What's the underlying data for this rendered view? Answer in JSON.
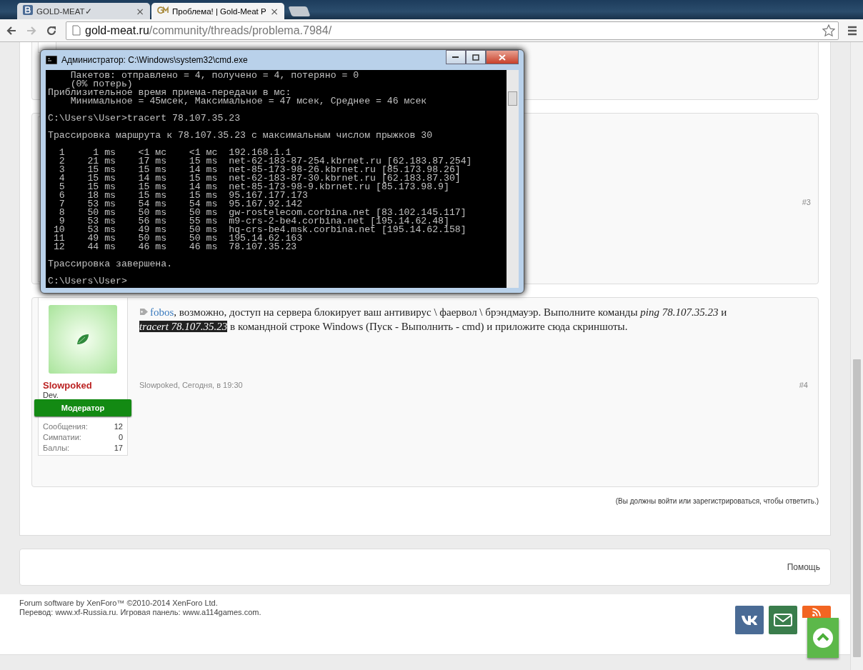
{
  "browser": {
    "tabs": [
      {
        "title": "GOLD-MEAT✓",
        "selected": false
      },
      {
        "title": "Проблема! | Gold-Meat P",
        "selected": true
      }
    ],
    "close_glyph": "×",
    "url_host": "gold-meat.ru",
    "url_path": "/community/threads/problema.7984/"
  },
  "earlier_post_number": "#3",
  "console": {
    "title": "Администратор: C:\\Windows\\system32\\cmd.exe",
    "blocks": [
      [
        "    Пакетов: отправлено = 4, получено = 4, потеряно = 0",
        "    (0% потерь)",
        "Приблизительное время приема-передачи в мс:",
        "    Минимальное = 45мсек, Максимальное = 47 мсек, Среднее = 46 мсек"
      ],
      [
        "C:\\Users\\User>tracert 78.107.35.23"
      ],
      [
        "Трассировка маршрута к 78.107.35.23 с максимальным числом прыжков 30"
      ],
      [
        "  1     1 ms    <1 мс    <1 мс  192.168.1.1",
        "  2    21 ms    17 ms    15 ms  net-62-183-87-254.kbrnet.ru [62.183.87.254]",
        "  3    15 ms    15 ms    14 ms  net-85-173-98-26.kbrnet.ru [85.173.98.26]",
        "  4    15 ms    14 ms    15 ms  net-62-183-87-30.kbrnet.ru [62.183.87.30]",
        "  5    15 ms    15 ms    14 ms  net-85-173-98-9.kbrnet.ru [85.173.98.9]",
        "  6    18 ms    15 ms    15 ms  95.167.177.173",
        "  7    53 ms    54 ms    54 ms  95.167.92.142",
        "  8    50 ms    50 ms    50 ms  gw-rostelecom.corbina.net [83.102.145.117]",
        "  9    53 ms    56 ms    55 ms  m9-crs-2-be4.corbina.net [195.14.62.48]",
        " 10    53 ms    49 ms    50 ms  hq-crs-be4.msk.corbina.net [195.14.62.158]",
        " 11    49 ms    50 ms    50 ms  195.14.62.163",
        " 12    44 ms    46 ms    46 ms  78.107.35.23"
      ],
      [
        "Трассировка завершена."
      ],
      [
        "C:\\Users\\User>"
      ]
    ]
  },
  "post": {
    "author": "Slowpoked",
    "title": "Dev.",
    "banner": "Модератор",
    "stats": [
      {
        "label": "Сообщения:",
        "value": "12"
      },
      {
        "label": "Симпатии:",
        "value": "0"
      },
      {
        "label": "Баллы:",
        "value": "17"
      }
    ],
    "message": [
      {
        "kind": "mention",
        "text": "fobos"
      },
      {
        "kind": "text",
        "text": ", возможно, доступ на сервера блокирует ваш антивирус \\ фаервол \\ брэндмауэр. Выполните команды "
      },
      {
        "kind": "italic",
        "text": "ping 78.107.35.23"
      },
      {
        "kind": "text",
        "text": " и "
      },
      {
        "kind": "selected",
        "text": "tracert 78.107.35.23"
      },
      {
        "kind": "text",
        "text": " в командной строке Windows (Пуск - Выполнить - cmd) и приложите сюда скриншоты."
      }
    ],
    "meta": "Slowpoked, Сегодня, в 19:30",
    "number": "#4"
  },
  "login_notice": "(Вы должны войти или зарегистрироваться, чтобы ответить.)",
  "footer": {
    "help": "Помощь",
    "copyright": "Forum software by XenForo™ ©2010-2014 XenForo Ltd.",
    "credits": "Перевод: www.xf-Russia.ru. Игровая панель: www.a114games.com.",
    "social": [
      {
        "kind": "vk",
        "color": "#4a6b95"
      },
      {
        "kind": "mail",
        "color": "#3a7d4c"
      },
      {
        "kind": "rss",
        "color": "#f26522"
      }
    ]
  }
}
